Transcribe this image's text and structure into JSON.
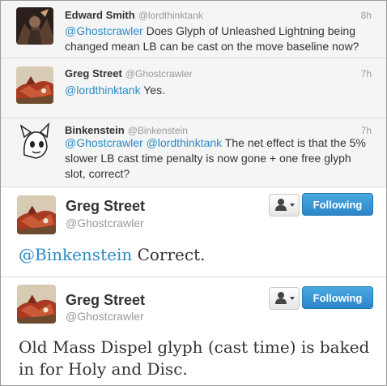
{
  "replies": [
    {
      "name": "Edward Smith",
      "handle": "@lordthinktank",
      "time": "8h",
      "text_parts": [
        {
          "text": "@Ghostcrawler",
          "mention": true
        },
        {
          "text": " Does Glyph of Unleashed Lightning being changed mean LB can be cast on the move baseline now?",
          "mention": false
        }
      ]
    },
    {
      "name": "Greg Street",
      "handle": "@Ghostcrawler",
      "time": "7h",
      "text_parts": [
        {
          "text": "@lordthinktank",
          "mention": true
        },
        {
          "text": " Yes.",
          "mention": false
        }
      ]
    },
    {
      "name": "Binkenstein",
      "handle": "@Binkenstein",
      "time": "7h",
      "text_parts": [
        {
          "text": "@Ghostcrawler",
          "mention": true
        },
        {
          "text": " ",
          "mention": false
        },
        {
          "text": "@lordthinktank",
          "mention": true
        },
        {
          "text": " The net effect is that the 5% slower LB cast time penalty is now gone + one free glyph slot, correct?",
          "mention": false
        }
      ]
    }
  ],
  "tweets": [
    {
      "name": "Greg Street",
      "handle": "@Ghostcrawler",
      "follow_label": "Following",
      "text_parts": [
        {
          "text": "@Binkenstein",
          "mention": true
        },
        {
          "text": " Correct.",
          "mention": false
        }
      ]
    },
    {
      "name": "Greg Street",
      "handle": "@Ghostcrawler",
      "follow_label": "Following",
      "text_parts": [
        {
          "text": "Old Mass Dispel glyph (cast time) is baked in for Holy and Disc.",
          "mention": false
        }
      ]
    }
  ],
  "colors": {
    "mention": "#2b8bc4",
    "follow_button": "#3a97d5",
    "reply_background": "#f5f5f5"
  },
  "icons": {
    "user_dropdown": "user-icon",
    "caret": "caret-down-icon"
  }
}
